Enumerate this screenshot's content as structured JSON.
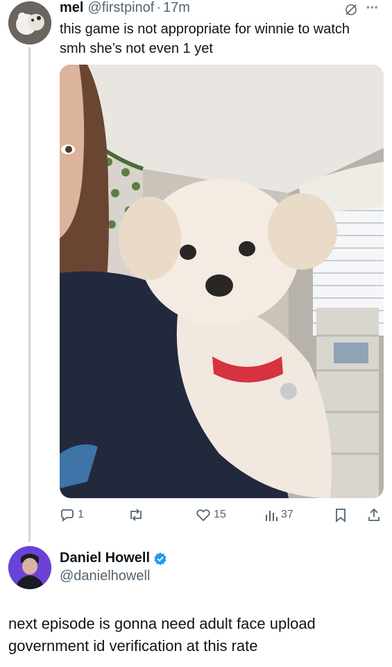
{
  "tweet": {
    "author_name": "mel",
    "handle": "@firstpinof",
    "separator": "·",
    "time": "17m",
    "text": "this game is not appropriate for winnie to watch smh she’s not even 1 yet",
    "image_icon": "photo-dog-on-shoulder",
    "mute_icon": "mute-icon",
    "more_icon": "more-icon",
    "metrics": {
      "replies": "1",
      "likes": "15",
      "views": "37"
    }
  },
  "reply": {
    "author_name": "Daniel Howell",
    "handle": "@danielhowell",
    "verified_icon": "verified-badge-icon",
    "text": "next episode is gonna need adult face upload government id verification at this rate"
  },
  "colors": {
    "secondary": "#536471",
    "verified": "#1d9bf0",
    "thread_line": "#cfd9de"
  }
}
